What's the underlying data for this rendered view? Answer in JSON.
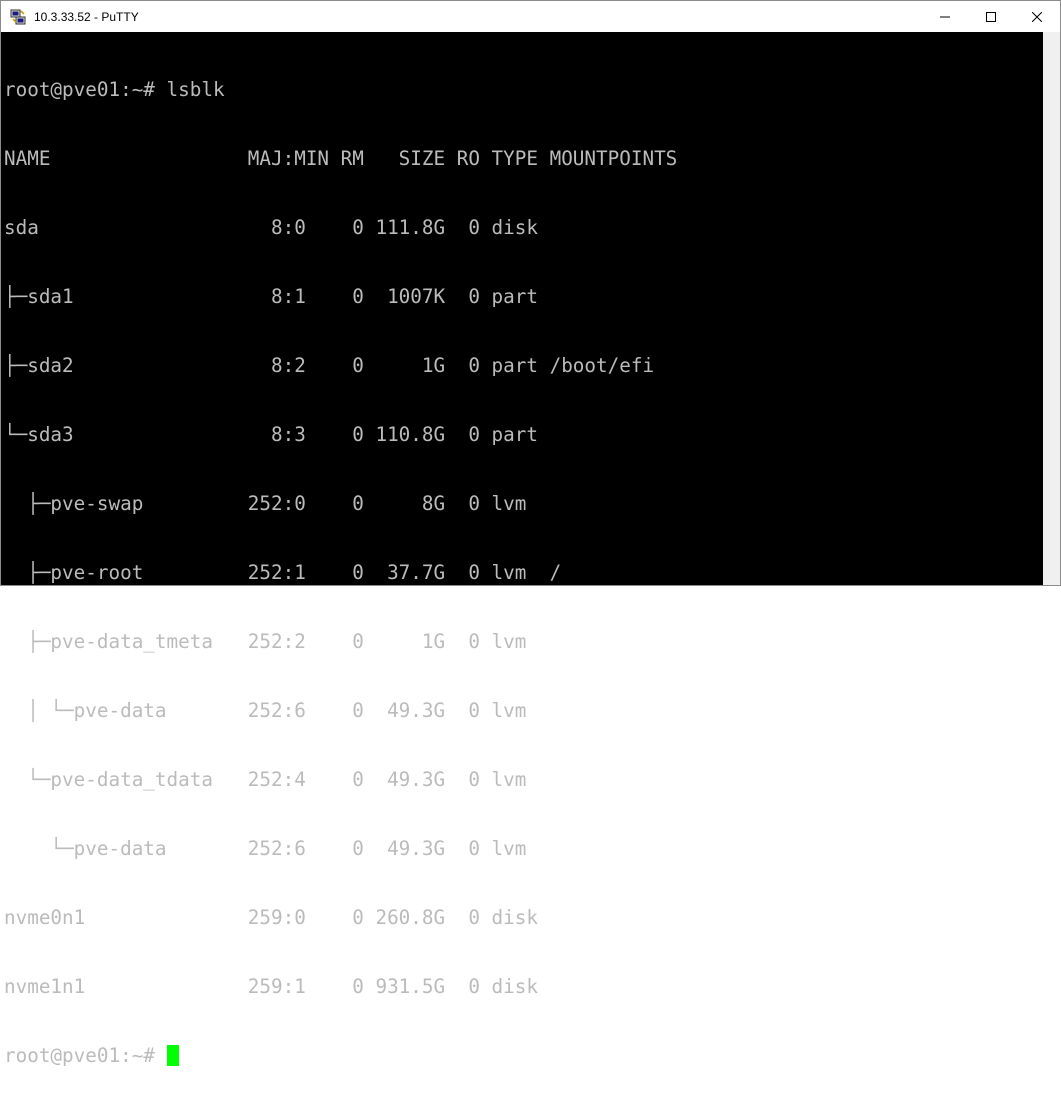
{
  "window": {
    "title": "10.3.33.52 - PuTTY",
    "app_icon": "putty-icon",
    "controls": [
      "minimize-icon",
      "maximize-icon",
      "close-icon"
    ]
  },
  "terminal": {
    "lines": [
      "root@pve01:~# lsblk",
      "NAME                 MAJ:MIN RM   SIZE RO TYPE MOUNTPOINTS",
      "sda                    8:0    0 111.8G  0 disk",
      "├─sda1                 8:1    0  1007K  0 part",
      "├─sda2                 8:2    0     1G  0 part /boot/efi",
      "└─sda3                 8:3    0 110.8G  0 part",
      "  ├─pve-swap         252:0    0     8G  0 lvm",
      "  ├─pve-root         252:1    0  37.7G  0 lvm  /",
      "  ├─pve-data_tmeta   252:2    0     1G  0 lvm",
      "  │ └─pve-data       252:6    0  49.3G  0 lvm",
      "  └─pve-data_tdata   252:4    0  49.3G  0 lvm",
      "    └─pve-data       252:6    0  49.3G  0 lvm",
      "nvme0n1              259:0    0 260.8G  0 disk",
      "nvme1n1              259:1    0 931.5G  0 disk"
    ],
    "prompt": "root@pve01:~#",
    "text_color": "#bbbbbb",
    "background": "#000000",
    "cursor_color": "#00ff00"
  }
}
